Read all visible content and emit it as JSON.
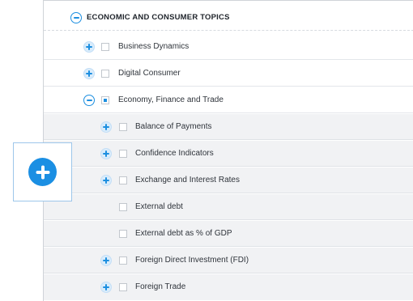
{
  "tree": {
    "header": {
      "label": "ECONOMIC AND CONSUMER TOPICS",
      "state": "expanded"
    },
    "items": [
      {
        "label": "Business Dynamics",
        "toggle": "plus",
        "checkbox": "unchecked"
      },
      {
        "label": "Digital Consumer",
        "toggle": "plus",
        "checkbox": "unchecked"
      },
      {
        "label": "Economy, Finance and Trade",
        "toggle": "minus",
        "checkbox": "partial"
      }
    ],
    "children": [
      {
        "label": "Balance of Payments",
        "toggle": "plus",
        "checkbox": "unchecked"
      },
      {
        "label": "Confidence Indicators",
        "toggle": "plus",
        "checkbox": "unchecked"
      },
      {
        "label": "Exchange and Interest Rates",
        "toggle": "plus",
        "checkbox": "unchecked"
      },
      {
        "label": "External debt",
        "toggle": "none",
        "checkbox": "unchecked"
      },
      {
        "label": "External debt as % of GDP",
        "toggle": "none",
        "checkbox": "unchecked"
      },
      {
        "label": "Foreign Direct Investment (FDI)",
        "toggle": "plus",
        "checkbox": "unchecked"
      },
      {
        "label": "Foreign Trade",
        "toggle": "plus",
        "checkbox": "unchecked"
      }
    ]
  },
  "floating_button": {
    "icon": "plus-circle-icon"
  },
  "colors": {
    "accent": "#1b8fe3",
    "toggle_plus_bg": "#d9ecfb",
    "child_row_bg": "#f1f2f4",
    "border": "#cfd3d8"
  }
}
